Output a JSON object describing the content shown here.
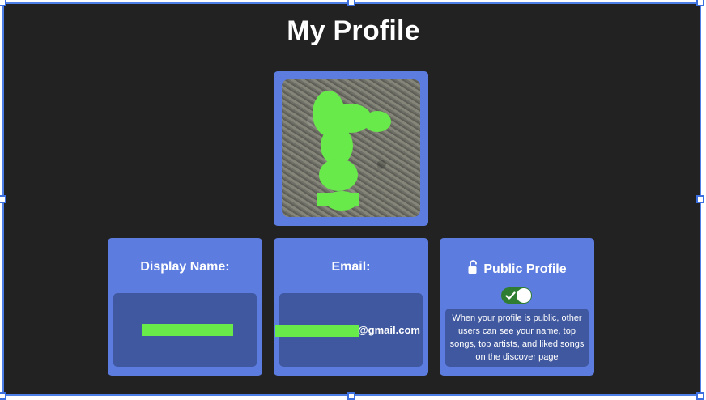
{
  "page": {
    "title": "My Profile"
  },
  "colors": {
    "background": "#222222",
    "card": "#5c7ce0",
    "card_inner": "#40589f",
    "toggle_on": "#2f7d32",
    "selection": "#3b6fe0"
  },
  "avatar": {
    "alt_icon": "profile-photo"
  },
  "display_name_card": {
    "label": "Display Name:",
    "value": ""
  },
  "email_card": {
    "label": "Email:",
    "value_suffix": "@gmail.com"
  },
  "public_profile_card": {
    "icon": "unlock-icon",
    "label": "Public Profile",
    "toggle_on": true,
    "description": "When your profile is public, other users can see your name, top songs, top artists, and liked songs on the discover page"
  }
}
